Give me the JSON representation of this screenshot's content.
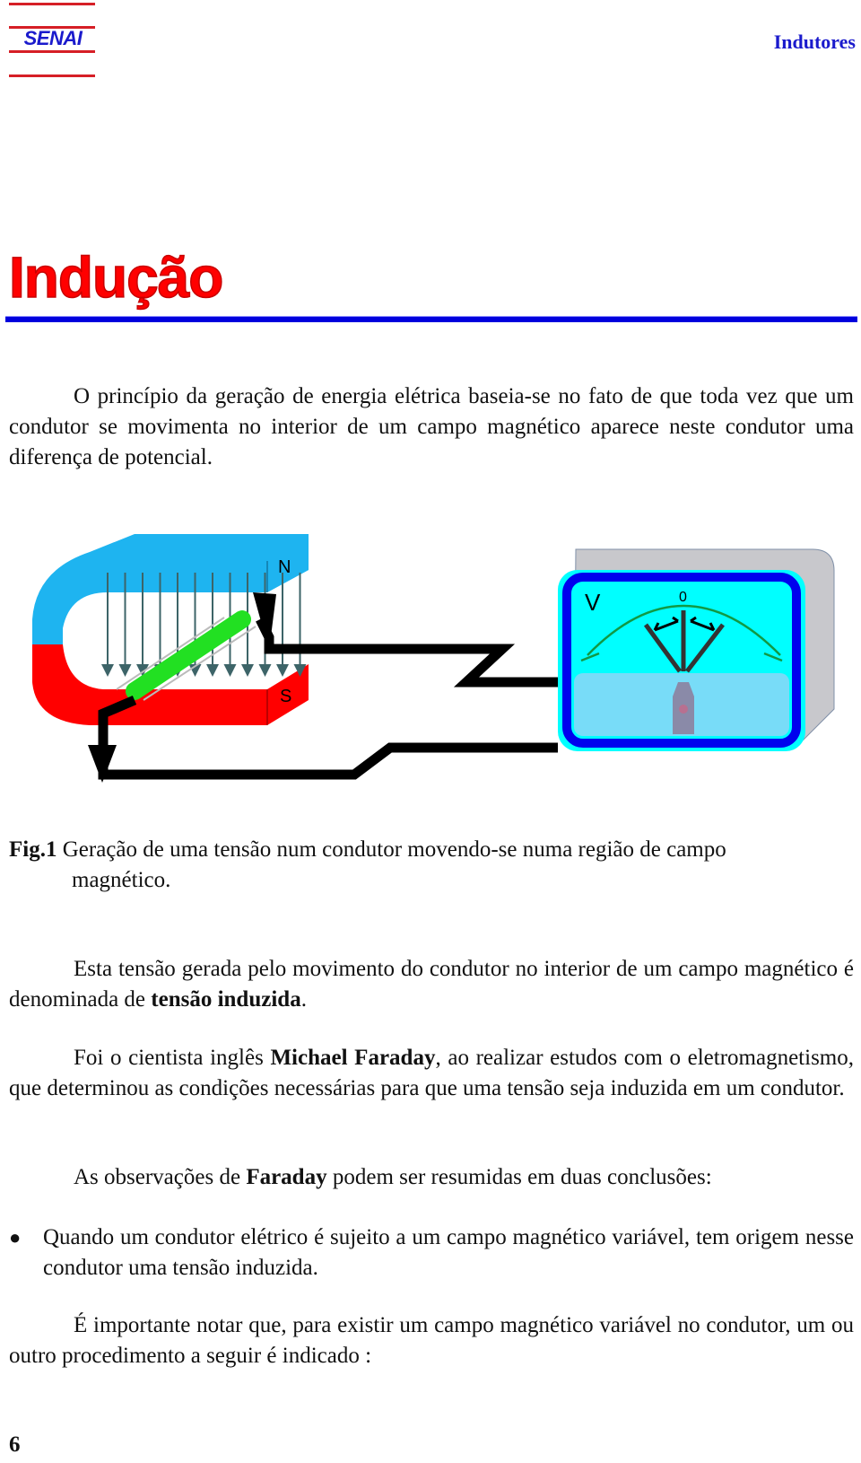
{
  "header": {
    "logo": "SENAI",
    "title": "Indutores"
  },
  "section": {
    "title": "Indução"
  },
  "paragraphs": {
    "p1": "O princípio da geração de energia elétrica baseia-se no fato de que toda vez que um condutor se movimenta no interior de um campo magnético aparece neste condutor uma diferença de potencial.",
    "p2_pre": "Esta tensão gerada pelo movimento do condutor no interior de um campo magnético é denominada de ",
    "p2_bold": "tensão induzida",
    "p2_post": ".",
    "p3_pre": "Foi o cientista inglês ",
    "p3_bold": "Michael Faraday",
    "p3_post": ", ao realizar estudos com o eletromagnetismo, que determinou as condições necessárias para que uma tensão seja induzida em um condutor.",
    "p4_pre": "As observações de ",
    "p4_bold": "Faraday",
    "p4_post": " podem ser resumidas em duas conclusões:",
    "bullet1": "Quando um condutor elétrico é sujeito a um campo magnético variável, tem origem nesse condutor uma tensão induzida.",
    "p5": "É importante notar que, para existir um campo magnético variável no condutor, um ou outro procedimento a seguir é indicado :"
  },
  "figure": {
    "north_label": "N",
    "south_label": "S",
    "meter_unit": "V",
    "meter_zero": "0",
    "colors": {
      "north_pole": "#1eb4f0",
      "south_pole": "#ff0000",
      "conductor": "#22e022",
      "field_lines": "#3d6468",
      "meter_face": "#00ffff",
      "meter_frame": "#0000ee",
      "meter_case": "#c8c8cc",
      "scale_arc": "#119944"
    },
    "caption_label": "Fig.1",
    "caption_text": "Geração de uma tensão num condutor movendo-se numa região de campo",
    "caption_text_line2": "magnético."
  },
  "footer": {
    "page_number": "6"
  }
}
